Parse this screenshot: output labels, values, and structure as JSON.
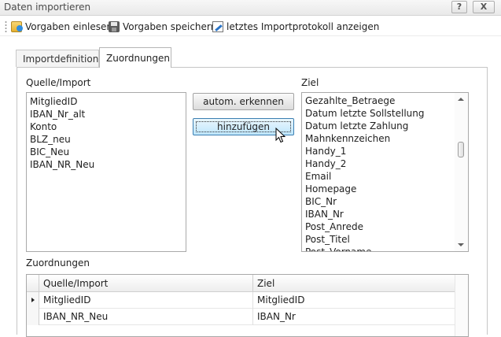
{
  "window": {
    "title": "Daten importieren",
    "help_label": "?",
    "close_label": "X"
  },
  "toolbar": {
    "items": [
      {
        "label": "Vorgaben einlesen",
        "icon": "folder-icon"
      },
      {
        "label": "Vorgaben speichern",
        "icon": "save-disk-icon"
      },
      {
        "label": "letztes Importprotokoll anzeigen",
        "icon": "document-edit-icon"
      }
    ]
  },
  "tabs": [
    {
      "label": "Importdefinition",
      "active": false
    },
    {
      "label": "Zuordnungen",
      "active": true
    }
  ],
  "source": {
    "label": "Quelle/Import",
    "items": [
      "MitgliedID",
      "IBAN_Nr_alt",
      "Konto",
      "BLZ_neu",
      "BIC_Neu",
      "IBAN_NR_Neu"
    ]
  },
  "target": {
    "label": "Ziel",
    "items": [
      "Gezahlte_Betraege",
      "Datum letzte Sollstellung",
      "Datum letzte Zahlung",
      "Mahnkennzeichen",
      "Handy_1",
      "Handy_2",
      "Email",
      "Homepage",
      "BIC_Nr",
      "IBAN_Nr",
      "Post_Anrede",
      "Post_Titel",
      "Post_Vorname"
    ]
  },
  "buttons": {
    "auto_label": "autom. erkennen",
    "add_label": "hinzufügen"
  },
  "mappings": {
    "label": "Zuordnungen",
    "columns": [
      "Quelle/Import",
      "Ziel"
    ],
    "rows": [
      {
        "source": "MitgliedID",
        "target": "MitgliedID",
        "current": true
      },
      {
        "source": "IBAN_NR_Neu",
        "target": "IBAN_Nr",
        "current": false
      }
    ]
  },
  "colors": {
    "accent": "#3c7fb1",
    "button_hover": "#bee6fd"
  }
}
